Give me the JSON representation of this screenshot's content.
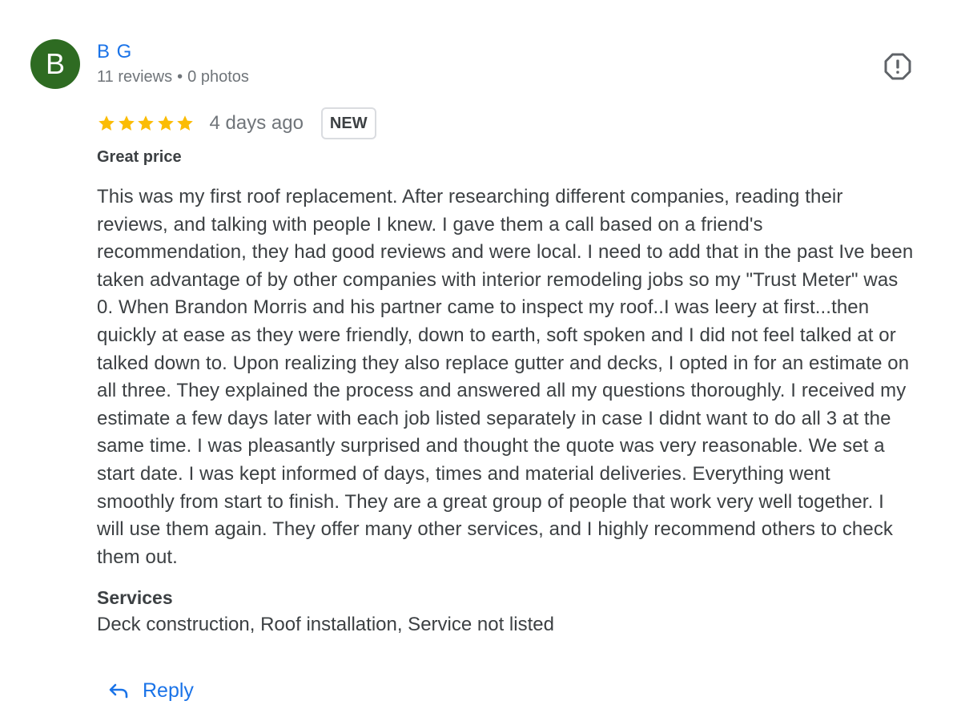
{
  "author": {
    "initial": "B",
    "avatar_color": "#2e6b22",
    "name": "B G",
    "reviews_count": "11 reviews",
    "separator": "•",
    "photos_count": "0 photos"
  },
  "report_icon": "report-icon",
  "rating": {
    "stars": 5,
    "max_stars": 5,
    "star_color": "#fbbc04",
    "time_ago": "4 days ago",
    "badge": "NEW"
  },
  "review": {
    "title": "Great price",
    "lines": [
      "This was my first roof replacement. After researching different companies, reading their",
      "reviews, and talking with people I knew. I gave them a call based on a friend's",
      "recommendation, they had good reviews and were local. I need to add that in the past Ive been",
      "taken advantage of by other companies with interior remodeling jobs so my \"Trust Meter\" was",
      "0. When Brandon Morris and his partner came to inspect my roof..I was leery at first...then",
      "quickly at ease as they were friendly, down to earth, soft spoken and I did not feel talked at or",
      "talked down to. Upon realizing they also replace gutter and decks, I opted in for an estimate on",
      "all three. They explained the process and answered all my questions thoroughly. I received my",
      "estimate a few days later with each job listed separately in case I didnt want to do all 3 at the",
      "same time. I was pleasantly surprised and thought the quote was very reasonable. We set a",
      "start date. I was kept informed of days, times and material deliveries. Everything went",
      "smoothly from start to finish. They are a great group of people that work very well together. I",
      "will use them again. They offer many other services, and I highly recommend others to check",
      "them out."
    ]
  },
  "services": {
    "label": "Services",
    "value": "Deck construction, Roof installation, Service not listed"
  },
  "reply": {
    "label": "Reply",
    "icon": "reply-icon"
  },
  "colors": {
    "link": "#1a73e8",
    "text": "#3c4043",
    "muted": "#70757a"
  }
}
